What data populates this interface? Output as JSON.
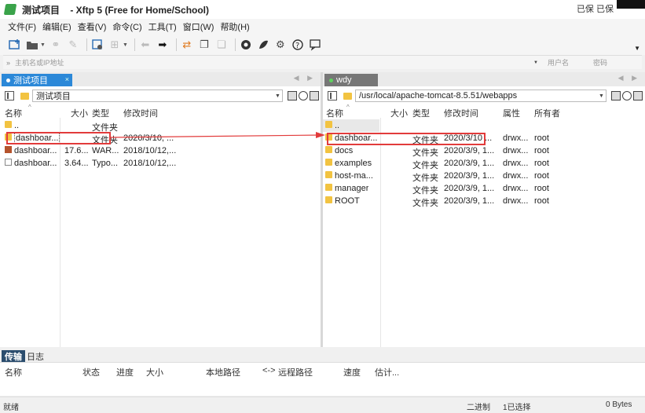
{
  "window": {
    "title": "测试项目    - Xftp 5 (Free for Home/School)",
    "corner_text": "已保  已保"
  },
  "menu": [
    "文件(F)",
    "编辑(E)",
    "查看(V)",
    "命令(C)",
    "工具(T)",
    "窗口(W)",
    "帮助(H)"
  ],
  "toolbar": {
    "icons": [
      "new-session-icon",
      "open-folder-icon",
      "link-icon",
      "unlink-icon",
      "properties-icon",
      "new-tab-icon",
      "back-icon",
      "forward-icon",
      "transfer-icon",
      "copy-icon",
      "paste-icon",
      "xshell-icon",
      "xftp-icon",
      "settings-icon",
      "help-icon",
      "message-icon"
    ]
  },
  "address": {
    "placeholder": "主机名或IP地址",
    "user_placeholder": "用户名",
    "password_placeholder": "密码"
  },
  "left_pane": {
    "tab": "测试项目",
    "path": "测试项目",
    "columns": {
      "name": "名称",
      "size": "大小",
      "type": "类型",
      "modified": "修改时间"
    },
    "rows": [
      {
        "name": "..",
        "size": "",
        "type": "文件夹",
        "modified": "",
        "icon": "folder"
      },
      {
        "name": "dashboar...",
        "size": "",
        "type": "文件夹",
        "modified": "2020/3/10, ...",
        "icon": "folder"
      },
      {
        "name": "dashboar...",
        "size": "17.6...",
        "type": "WAR...",
        "modified": "2018/10/12,...",
        "icon": "war"
      },
      {
        "name": "dashboar...",
        "size": "3.64...",
        "type": "Typo...",
        "modified": "2018/10/12,...",
        "icon": "doc"
      }
    ]
  },
  "right_pane": {
    "tab": "wdy",
    "path": "/usr/local/apache-tomcat-8.5.51/webapps",
    "columns": {
      "name": "名称",
      "size": "大小",
      "type": "类型",
      "modified": "修改时间",
      "attr": "属性",
      "owner": "所有者"
    },
    "rows": [
      {
        "name": "..",
        "type": "",
        "modified": "",
        "attr": "",
        "owner": ""
      },
      {
        "name": "dashboar...",
        "type": "文件夹",
        "modified": "2020/3/10 ...",
        "attr": "drwx...",
        "owner": "root"
      },
      {
        "name": "docs",
        "type": "文件夹",
        "modified": "2020/3/9, 1...",
        "attr": "drwx...",
        "owner": "root"
      },
      {
        "name": "examples",
        "type": "文件夹",
        "modified": "2020/3/9, 1...",
        "attr": "drwx...",
        "owner": "root"
      },
      {
        "name": "host-ma...",
        "type": "文件夹",
        "modified": "2020/3/9, 1...",
        "attr": "drwx...",
        "owner": "root"
      },
      {
        "name": "manager",
        "type": "文件夹",
        "modified": "2020/3/9, 1...",
        "attr": "drwx...",
        "owner": "root"
      },
      {
        "name": "ROOT",
        "type": "文件夹",
        "modified": "2020/3/9, 1...",
        "attr": "drwx...",
        "owner": "root"
      }
    ]
  },
  "transfer_panel": {
    "tabs": [
      "传输",
      "日志"
    ],
    "columns": [
      "名称",
      "状态",
      "进度",
      "大小",
      "本地路径",
      "<->",
      "远程路径",
      "速度",
      "估计..."
    ]
  },
  "status": {
    "left": "就绪",
    "mode": "二进制",
    "selected": "1已选择",
    "bytes": "0 Bytes"
  },
  "colors": {
    "accent_tab": "#2b88d8",
    "annotation": "#e23b3b",
    "folder": "#f2c341"
  }
}
